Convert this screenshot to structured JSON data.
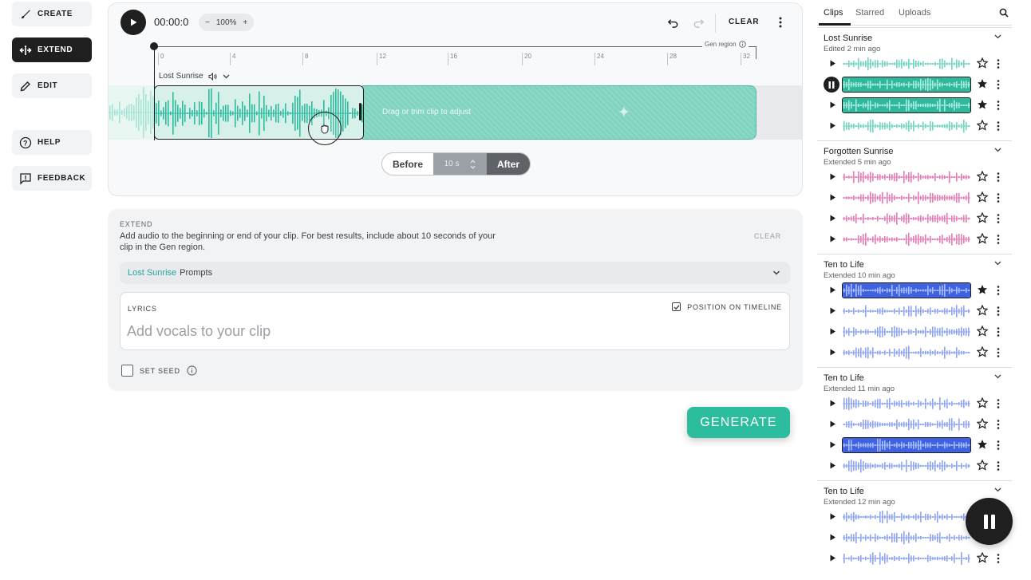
{
  "nav": {
    "create": "CREATE",
    "extend": "EXTEND",
    "edit": "EDIT",
    "help": "HELP",
    "feedback": "FEEDBACK"
  },
  "timeline": {
    "time": "00:00:0",
    "zoom": "100%",
    "zoom_minus": "−",
    "zoom_plus": "+",
    "clear_label": "CLEAR",
    "gen_region_label": "Gen region",
    "ticks": [
      "0",
      "4",
      "8",
      "12",
      "16",
      "20",
      "24",
      "28",
      "32"
    ],
    "clip_name": "Lost Sunrise",
    "drag_hint": "Drag or trim clip to adjust",
    "before_label": "Before",
    "seconds_value": "10",
    "seconds_unit": "s",
    "after_label": "After",
    "accent_color": "#2bbd9d"
  },
  "extend": {
    "heading": "EXTEND",
    "description": "Add audio to the beginning or end of your clip. For best results, include about 10 seconds of your clip in the Gen region.",
    "clear_label": "CLEAR",
    "prompts_song": "Lost Sunrise",
    "prompts_label": "Prompts",
    "lyrics_label": "LYRICS",
    "lyrics_placeholder": "Add vocals to your clip",
    "position_label": "POSITION ON TIMELINE",
    "position_checked": true,
    "seed_label": "SET SEED",
    "seed_checked": false,
    "generate_label": "GENERATE"
  },
  "sidebar": {
    "tabs": [
      "Clips",
      "Starred",
      "Uploads"
    ],
    "active_tab": "Clips",
    "groups": [
      {
        "title": "Lost Sunrise",
        "subtitle": "Edited 2 min ago",
        "color": "#6ed6c2",
        "clips": [
          {
            "starred": false,
            "playing": false,
            "selected": false
          },
          {
            "starred": true,
            "playing": true,
            "selected": true
          },
          {
            "starred": true,
            "playing": false,
            "selected": true
          },
          {
            "starred": false,
            "playing": false,
            "selected": false
          }
        ]
      },
      {
        "title": "Forgotten Sunrise",
        "subtitle": "Extended 5 min ago",
        "color": "#e77bb6",
        "clips": [
          {
            "starred": false,
            "playing": false,
            "selected": false
          },
          {
            "starred": false,
            "playing": false,
            "selected": false
          },
          {
            "starred": false,
            "playing": false,
            "selected": false
          },
          {
            "starred": false,
            "playing": false,
            "selected": false
          }
        ]
      },
      {
        "title": "Ten to Life",
        "subtitle": "Extended 10 min ago",
        "color": "#8ea4f4",
        "clips": [
          {
            "starred": true,
            "playing": false,
            "selected": true
          },
          {
            "starred": false,
            "playing": false,
            "selected": false
          },
          {
            "starred": false,
            "playing": false,
            "selected": false
          },
          {
            "starred": false,
            "playing": false,
            "selected": false
          }
        ]
      },
      {
        "title": "Ten to Life",
        "subtitle": "Extended 11 min ago",
        "color": "#8ea4f4",
        "clips": [
          {
            "starred": false,
            "playing": false,
            "selected": false
          },
          {
            "starred": false,
            "playing": false,
            "selected": false
          },
          {
            "starred": true,
            "playing": false,
            "selected": true
          },
          {
            "starred": false,
            "playing": false,
            "selected": false
          }
        ]
      },
      {
        "title": "Ten to Life",
        "subtitle": "Extended 12 min ago",
        "color": "#8ea4f4",
        "clips": [
          {
            "starred": false,
            "playing": false,
            "selected": false
          },
          {
            "starred": false,
            "playing": false,
            "selected": false
          },
          {
            "starred": false,
            "playing": false,
            "selected": false
          }
        ]
      }
    ]
  }
}
